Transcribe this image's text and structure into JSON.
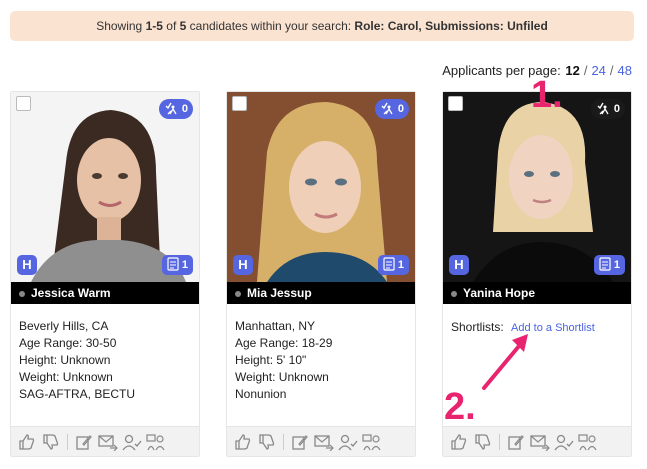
{
  "banner": {
    "prefix": "Showing",
    "range": "1-5",
    "of": "of",
    "total": "5",
    "suffix": "candidates within your search:",
    "role_label": "Role: Carol,",
    "submissions_label": "Submissions: Unfiled"
  },
  "pagination": {
    "label": "Applicants per page:",
    "options": [
      "12",
      "24",
      "48"
    ],
    "selected": "12"
  },
  "cards": [
    {
      "name": "Jessica Warm",
      "submissions_count": "0",
      "documents_count": "1",
      "details": [
        "Beverly Hills, CA",
        "Age Range: 30-50",
        "Height: Unknown",
        "Weight: Unknown",
        "SAG-AFTRA, BECTU"
      ]
    },
    {
      "name": "Mia Jessup",
      "submissions_count": "0",
      "documents_count": "1",
      "details": [
        "Manhattan, NY",
        "Age Range: 18-29",
        "Height: 5' 10\"",
        "Weight: Unknown",
        "Nonunion"
      ]
    },
    {
      "name": "Yanina Hope",
      "submissions_count": "0",
      "documents_count": "1",
      "shortlists_label": "Shortlists:",
      "shortlists_link": "Add to a Shortlist"
    }
  ],
  "annotations": {
    "step1": "1.",
    "step2": "2."
  },
  "logo_letter": "H",
  "colors": {
    "accent": "#5566e0",
    "link": "#4a63e0",
    "annotation": "#e8246f",
    "banner_bg": "#fbe3d2"
  },
  "icons": [
    "submissions-icon",
    "document-icon",
    "thumbs-up-icon",
    "thumbs-down-icon",
    "edit-icon",
    "email-forward-icon",
    "user-check-icon",
    "group-icon"
  ]
}
